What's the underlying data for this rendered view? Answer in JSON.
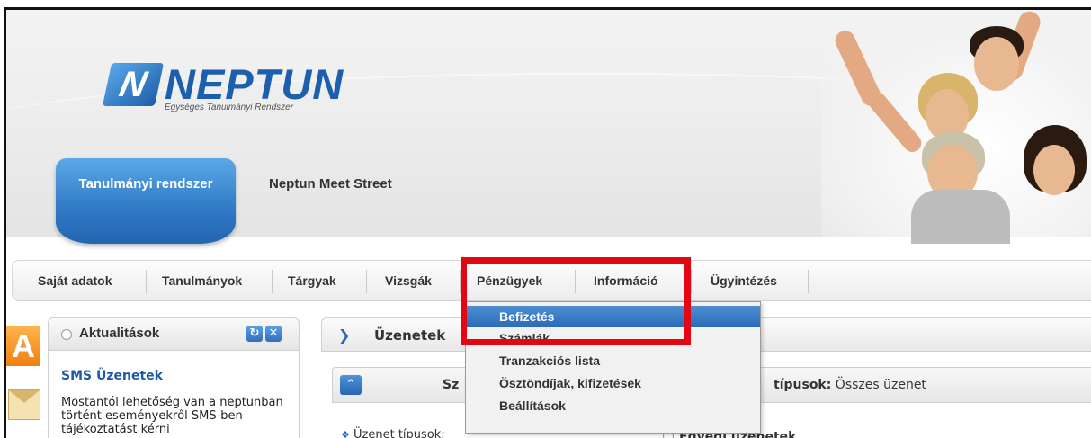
{
  "logo": {
    "name": "NEPTUN",
    "mark": "N",
    "subtitle": "Egységes Tanulmányi Rendszer"
  },
  "tabs": [
    {
      "label": "Tanulmányi rendszer",
      "active": true
    },
    {
      "label": "Neptun Meet Street",
      "active": false
    }
  ],
  "menu": [
    {
      "label": "Saját adatok"
    },
    {
      "label": "Tanulmányok"
    },
    {
      "label": "Tárgyak"
    },
    {
      "label": "Vizsgák"
    },
    {
      "label": "Pénzügyek"
    },
    {
      "label": "Információ"
    },
    {
      "label": "Ügyintézés"
    }
  ],
  "dropdown": [
    {
      "label": "Befizetés",
      "highlighted": true
    },
    {
      "label": "Számlák"
    },
    {
      "label": "Tranzakciós lista"
    },
    {
      "label": "Ösztöndíjak, kifizetések"
    },
    {
      "label": "Beállítások"
    }
  ],
  "news": {
    "title": "Aktualitások",
    "item_title": "SMS Üzenetek",
    "item_body": "Mostantól lehetőség van a neptunban történt eseményekről SMS-ben tájékoztatást kérni"
  },
  "messages": {
    "title": "Üzenetek",
    "filter_left": "Sz",
    "filter_right_label": "típusok:",
    "filter_right_value": "Összes üzenet",
    "types_label": "Üzenet típusok:",
    "individual": "Egyedi üzenetek"
  },
  "colors": {
    "accent": "#2a69b3",
    "highlight_box": "#e30613"
  }
}
